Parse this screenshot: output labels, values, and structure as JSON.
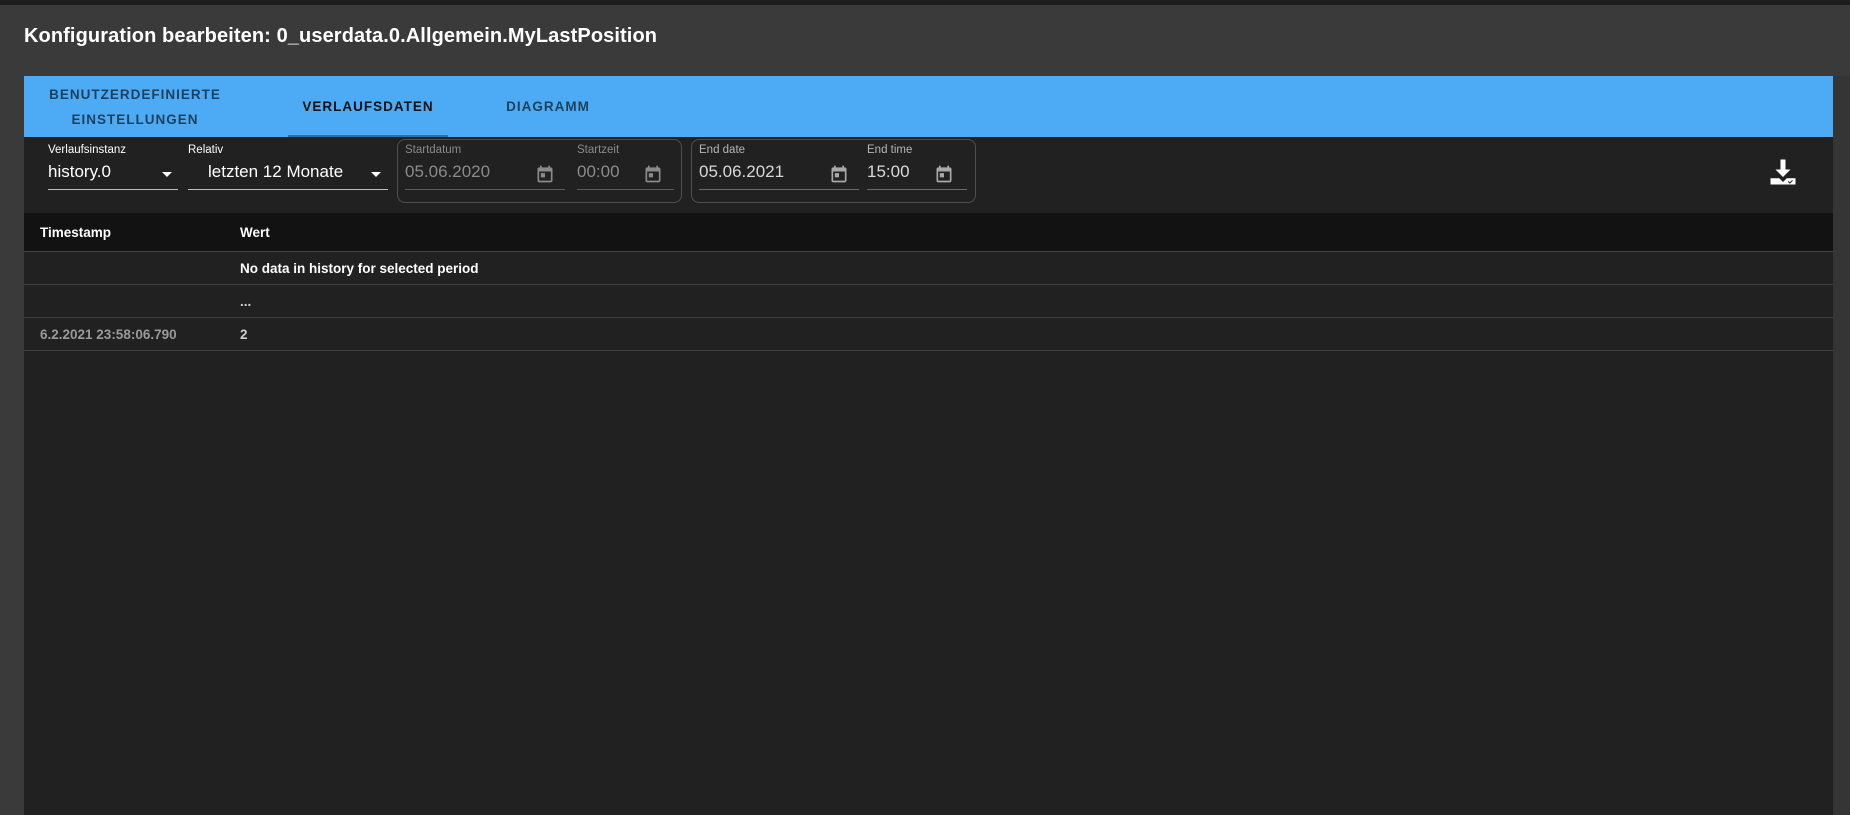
{
  "dialog": {
    "title": "Konfiguration bearbeiten: 0_userdata.0.Allgemein.MyLastPosition"
  },
  "tabs": [
    {
      "label_line1": "BENUTZERDEFINIERTE",
      "label_line2": "EINSTELLUNGEN",
      "active": false
    },
    {
      "label": "VERLAUFSDATEN",
      "active": true
    },
    {
      "label": "DIAGRAMM",
      "active": false
    }
  ],
  "toolbar": {
    "instance": {
      "label": "Verlaufsinstanz",
      "value": "history.0"
    },
    "relative": {
      "label": "Relativ",
      "value": "letzten 12 Monate"
    },
    "start_date": {
      "label": "Startdatum",
      "value": "05.06.2020"
    },
    "start_time": {
      "label": "Startzeit",
      "value": "00:00"
    },
    "end_date": {
      "label": "End date",
      "value": "05.06.2021"
    },
    "end_time": {
      "label": "End time",
      "value": "15:00"
    },
    "download_icon": "download-icon",
    "calendar_icon": "calendar-icon"
  },
  "table": {
    "columns": [
      "Timestamp",
      "Wert"
    ],
    "rows": [
      {
        "timestamp": "",
        "value": "No data in history for selected period"
      },
      {
        "timestamp": "",
        "value": "..."
      },
      {
        "timestamp": "6.2.2021 23:58:06.790",
        "value": "2"
      }
    ]
  },
  "colors": {
    "tab_bar": "#4dabf5",
    "background": "#212121",
    "dialog": "#3a3a3a"
  }
}
